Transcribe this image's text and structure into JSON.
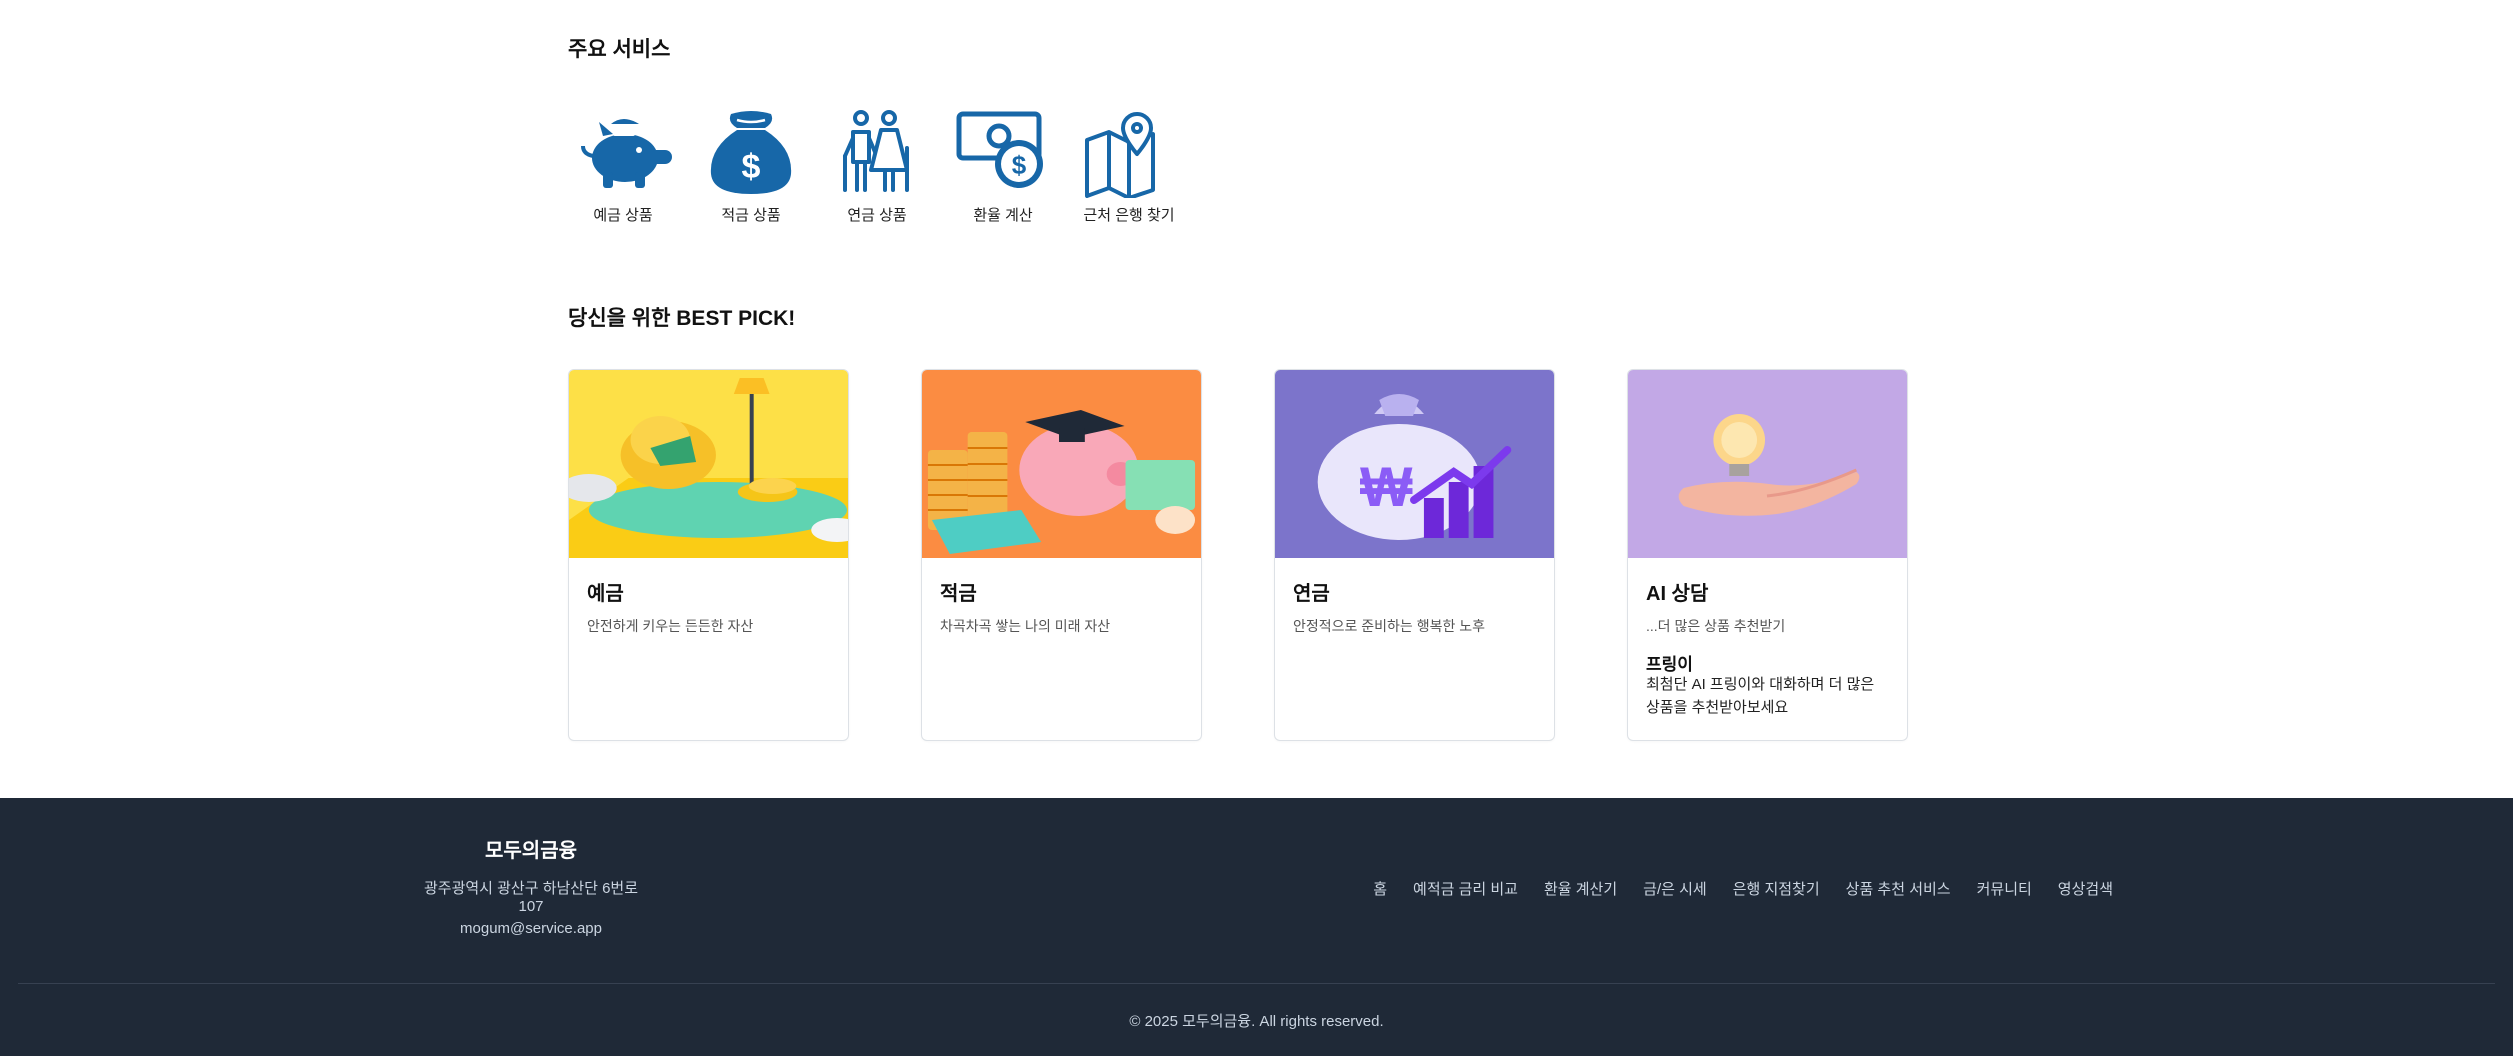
{
  "services": {
    "title": "주요 서비스",
    "items": [
      {
        "label": "예금 상품",
        "icon": "piggy-bank-icon"
      },
      {
        "label": "적금 상품",
        "icon": "money-bag-icon"
      },
      {
        "label": "연금 상품",
        "icon": "elderly-couple-icon"
      },
      {
        "label": "환율 계산",
        "icon": "cash-exchange-icon"
      },
      {
        "label": "근처 은행 찾기",
        "icon": "map-pin-icon"
      }
    ],
    "icon_color": "#1767a8"
  },
  "best_pick": {
    "title": "당신을 위한 BEST PICK!",
    "cards": [
      {
        "title": "예금",
        "desc": "안전하게 키우는 든든한 자산",
        "image": "yellow-armchair-coins-illustration",
        "bg": "#fde047"
      },
      {
        "title": "적금",
        "desc": "차곡차곡 쌓는 나의 미래 자산",
        "image": "piggy-bank-graduation-illustration",
        "bg": "#fb8c42"
      },
      {
        "title": "연금",
        "desc": "안정적으로 준비하는 행복한 노후",
        "image": "won-money-bag-chart-illustration",
        "bg": "#7c74cb"
      },
      {
        "title": "AI 상담",
        "desc": "...더 많은 상품 추천받기",
        "image": "hand-lightbulb-illustration",
        "bg": "#c2a8e6",
        "sub_title": "프링이",
        "sub_desc": "최첨단 AI 프링이와 대화하며 더 많은 상품을 추천받아보세요"
      }
    ]
  },
  "footer": {
    "brand": "모두의금융",
    "address": "광주광역시 광산구 하남산단 6번로 107",
    "email": "mogum@service.app",
    "nav": [
      "홈",
      "예적금 금리 비교",
      "환율 계산기",
      "금/은 시세",
      "은행 지점찾기",
      "상품 추천 서비스",
      "커뮤니티",
      "영상검색"
    ],
    "copyright": "© 2025 모두의금융. All rights reserved.",
    "bg": "#1f2937"
  }
}
